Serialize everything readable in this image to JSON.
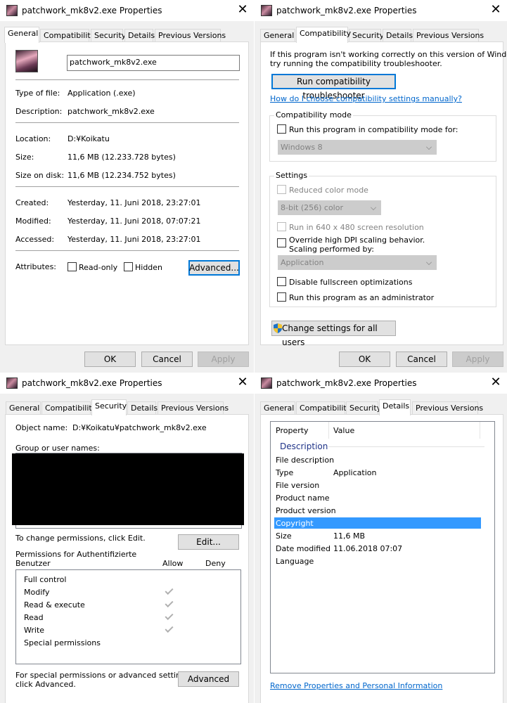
{
  "window_title": "patchwork_mk8v2.exe Properties",
  "tabs": {
    "general": "General",
    "compatibility": "Compatibility",
    "security": "Security",
    "details": "Details",
    "previous_versions": "Previous Versions"
  },
  "dialog_buttons": {
    "ok": "OK",
    "cancel": "Cancel",
    "apply": "Apply"
  },
  "general": {
    "file_name": "patchwork_mk8v2.exe",
    "type_label": "Type of file:",
    "type_value": "Application (.exe)",
    "description_label": "Description:",
    "description_value": "patchwork_mk8v2.exe",
    "location_label": "Location:",
    "location_value": "D:¥Koikatu",
    "size_label": "Size:",
    "size_value": "11,6 MB (12.233.728 bytes)",
    "size_on_disk_label": "Size on disk:",
    "size_on_disk_value": "11,6 MB (12.234.752 bytes)",
    "created_label": "Created:",
    "created_value": "Yesterday, 11. Juni 2018, 23:27:01",
    "modified_label": "Modified:",
    "modified_value": "Yesterday, 11. Juni 2018, 07:07:21",
    "accessed_label": "Accessed:",
    "accessed_value": "Yesterday, 11. Juni 2018, 23:27:01",
    "attributes_label": "Attributes:",
    "readonly_label": "Read-only",
    "hidden_label": "Hidden",
    "advanced_button": "Advanced..."
  },
  "compatibility": {
    "intro_line1": "If this program isn't working correctly on this version of Windows,",
    "intro_line2": "try running the compatibility troubleshooter.",
    "troubleshooter_button": "Run compatibility troubleshooter",
    "manual_link": "How do I choose compatibility settings manually?",
    "mode_group": "Compatibility mode",
    "mode_checkbox": "Run this program in compatibility mode for:",
    "mode_select": "Windows 8",
    "settings_group": "Settings",
    "reduced_color": "Reduced color mode",
    "color_select": "8-bit (256) color",
    "run_640": "Run in 640 x 480 screen resolution",
    "override_dpi_line1": "Override high DPI scaling behavior.",
    "override_dpi_line2": "Scaling performed by:",
    "dpi_select": "Application",
    "disable_fullscreen": "Disable fullscreen optimizations",
    "run_as_admin": "Run this program as an administrator",
    "change_all_users": "Change settings for all users"
  },
  "security": {
    "object_name_label": "Object name:",
    "object_name_value": "D:¥Koikatu¥patchwork_mk8v2.exe",
    "group_label": "Group or user names:",
    "change_permissions": "To change permissions, click Edit.",
    "edit_button": "Edit...",
    "permissions_for_line1": "Permissions for Authentifizierte",
    "permissions_for_line2": "Benutzer",
    "allow_header": "Allow",
    "deny_header": "Deny",
    "permissions": [
      {
        "name": "Full control",
        "allow": false
      },
      {
        "name": "Modify",
        "allow": true
      },
      {
        "name": "Read & execute",
        "allow": true
      },
      {
        "name": "Read",
        "allow": true
      },
      {
        "name": "Write",
        "allow": true
      },
      {
        "name": "Special permissions",
        "allow": false
      }
    ],
    "special_line1": "For special permissions or advanced settings,",
    "special_line2": "click Advanced.",
    "advanced_button": "Advanced"
  },
  "details": {
    "col_property": "Property",
    "col_value": "Value",
    "section": "Description",
    "rows": [
      {
        "property": "File description",
        "value": ""
      },
      {
        "property": "Type",
        "value": "Application"
      },
      {
        "property": "File version",
        "value": ""
      },
      {
        "property": "Product name",
        "value": ""
      },
      {
        "property": "Product version",
        "value": ""
      },
      {
        "property": "Copyright",
        "value": ""
      },
      {
        "property": "Size",
        "value": "11,6 MB"
      },
      {
        "property": "Date modified",
        "value": "11.06.2018 07:07"
      },
      {
        "property": "Language",
        "value": ""
      }
    ],
    "remove_link": "Remove Properties and Personal Information"
  },
  "colors": {
    "accent": "#0078d7",
    "link": "#0066cc",
    "selection": "#3399ff"
  }
}
